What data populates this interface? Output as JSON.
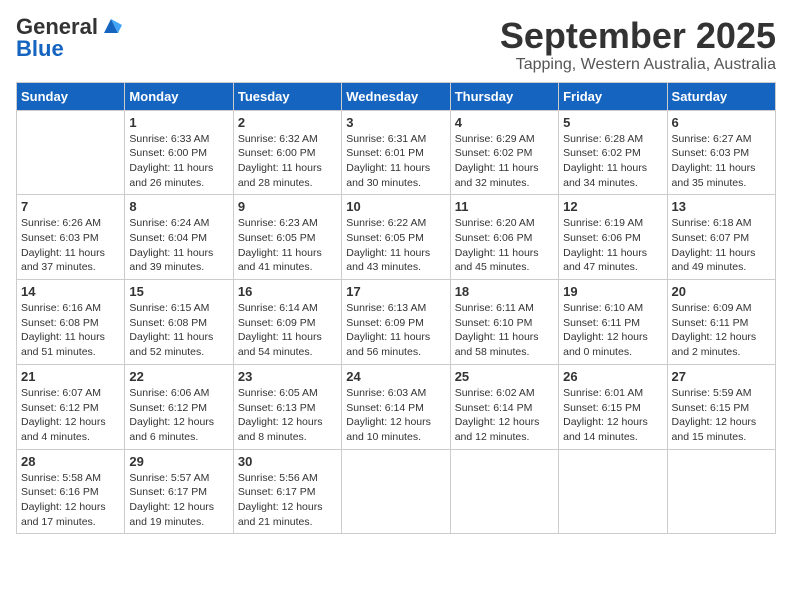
{
  "logo": {
    "general": "General",
    "blue": "Blue"
  },
  "title": "September 2025",
  "subtitle": "Tapping, Western Australia, Australia",
  "days_of_week": [
    "Sunday",
    "Monday",
    "Tuesday",
    "Wednesday",
    "Thursday",
    "Friday",
    "Saturday"
  ],
  "weeks": [
    [
      {
        "day": "",
        "info": ""
      },
      {
        "day": "1",
        "info": "Sunrise: 6:33 AM\nSunset: 6:00 PM\nDaylight: 11 hours\nand 26 minutes."
      },
      {
        "day": "2",
        "info": "Sunrise: 6:32 AM\nSunset: 6:00 PM\nDaylight: 11 hours\nand 28 minutes."
      },
      {
        "day": "3",
        "info": "Sunrise: 6:31 AM\nSunset: 6:01 PM\nDaylight: 11 hours\nand 30 minutes."
      },
      {
        "day": "4",
        "info": "Sunrise: 6:29 AM\nSunset: 6:02 PM\nDaylight: 11 hours\nand 32 minutes."
      },
      {
        "day": "5",
        "info": "Sunrise: 6:28 AM\nSunset: 6:02 PM\nDaylight: 11 hours\nand 34 minutes."
      },
      {
        "day": "6",
        "info": "Sunrise: 6:27 AM\nSunset: 6:03 PM\nDaylight: 11 hours\nand 35 minutes."
      }
    ],
    [
      {
        "day": "7",
        "info": "Sunrise: 6:26 AM\nSunset: 6:03 PM\nDaylight: 11 hours\nand 37 minutes."
      },
      {
        "day": "8",
        "info": "Sunrise: 6:24 AM\nSunset: 6:04 PM\nDaylight: 11 hours\nand 39 minutes."
      },
      {
        "day": "9",
        "info": "Sunrise: 6:23 AM\nSunset: 6:05 PM\nDaylight: 11 hours\nand 41 minutes."
      },
      {
        "day": "10",
        "info": "Sunrise: 6:22 AM\nSunset: 6:05 PM\nDaylight: 11 hours\nand 43 minutes."
      },
      {
        "day": "11",
        "info": "Sunrise: 6:20 AM\nSunset: 6:06 PM\nDaylight: 11 hours\nand 45 minutes."
      },
      {
        "day": "12",
        "info": "Sunrise: 6:19 AM\nSunset: 6:06 PM\nDaylight: 11 hours\nand 47 minutes."
      },
      {
        "day": "13",
        "info": "Sunrise: 6:18 AM\nSunset: 6:07 PM\nDaylight: 11 hours\nand 49 minutes."
      }
    ],
    [
      {
        "day": "14",
        "info": "Sunrise: 6:16 AM\nSunset: 6:08 PM\nDaylight: 11 hours\nand 51 minutes."
      },
      {
        "day": "15",
        "info": "Sunrise: 6:15 AM\nSunset: 6:08 PM\nDaylight: 11 hours\nand 52 minutes."
      },
      {
        "day": "16",
        "info": "Sunrise: 6:14 AM\nSunset: 6:09 PM\nDaylight: 11 hours\nand 54 minutes."
      },
      {
        "day": "17",
        "info": "Sunrise: 6:13 AM\nSunset: 6:09 PM\nDaylight: 11 hours\nand 56 minutes."
      },
      {
        "day": "18",
        "info": "Sunrise: 6:11 AM\nSunset: 6:10 PM\nDaylight: 11 hours\nand 58 minutes."
      },
      {
        "day": "19",
        "info": "Sunrise: 6:10 AM\nSunset: 6:11 PM\nDaylight: 12 hours\nand 0 minutes."
      },
      {
        "day": "20",
        "info": "Sunrise: 6:09 AM\nSunset: 6:11 PM\nDaylight: 12 hours\nand 2 minutes."
      }
    ],
    [
      {
        "day": "21",
        "info": "Sunrise: 6:07 AM\nSunset: 6:12 PM\nDaylight: 12 hours\nand 4 minutes."
      },
      {
        "day": "22",
        "info": "Sunrise: 6:06 AM\nSunset: 6:12 PM\nDaylight: 12 hours\nand 6 minutes."
      },
      {
        "day": "23",
        "info": "Sunrise: 6:05 AM\nSunset: 6:13 PM\nDaylight: 12 hours\nand 8 minutes."
      },
      {
        "day": "24",
        "info": "Sunrise: 6:03 AM\nSunset: 6:14 PM\nDaylight: 12 hours\nand 10 minutes."
      },
      {
        "day": "25",
        "info": "Sunrise: 6:02 AM\nSunset: 6:14 PM\nDaylight: 12 hours\nand 12 minutes."
      },
      {
        "day": "26",
        "info": "Sunrise: 6:01 AM\nSunset: 6:15 PM\nDaylight: 12 hours\nand 14 minutes."
      },
      {
        "day": "27",
        "info": "Sunrise: 5:59 AM\nSunset: 6:15 PM\nDaylight: 12 hours\nand 15 minutes."
      }
    ],
    [
      {
        "day": "28",
        "info": "Sunrise: 5:58 AM\nSunset: 6:16 PM\nDaylight: 12 hours\nand 17 minutes."
      },
      {
        "day": "29",
        "info": "Sunrise: 5:57 AM\nSunset: 6:17 PM\nDaylight: 12 hours\nand 19 minutes."
      },
      {
        "day": "30",
        "info": "Sunrise: 5:56 AM\nSunset: 6:17 PM\nDaylight: 12 hours\nand 21 minutes."
      },
      {
        "day": "",
        "info": ""
      },
      {
        "day": "",
        "info": ""
      },
      {
        "day": "",
        "info": ""
      },
      {
        "day": "",
        "info": ""
      }
    ]
  ]
}
